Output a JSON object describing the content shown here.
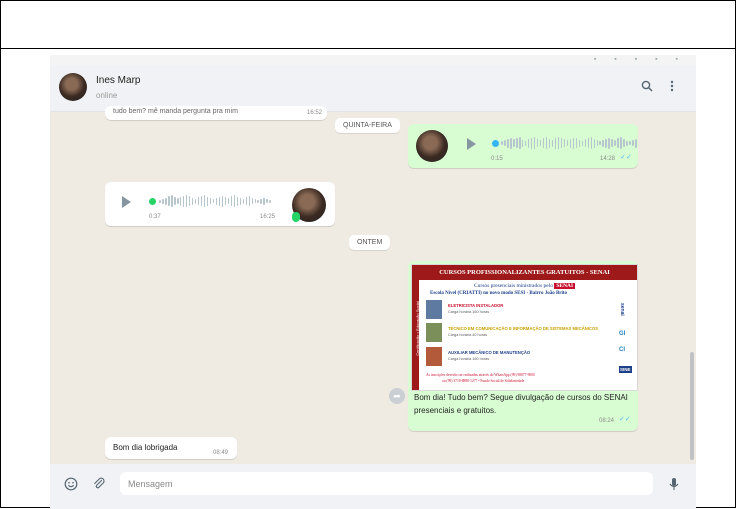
{
  "contact": {
    "name": "Ines Marp",
    "status": "online"
  },
  "messages": [
    {
      "type": "text",
      "direction": "incoming",
      "text": "tudo bem? mê manda pergunta pra mim",
      "time": "16:52"
    },
    {
      "type": "date",
      "text": "QUINTA-FEIRA"
    },
    {
      "type": "audio",
      "direction": "outgoing",
      "duration": "0:15",
      "time": "14:28",
      "status": "read"
    },
    {
      "type": "audio",
      "direction": "incoming",
      "duration": "0:37",
      "time": "16:25"
    },
    {
      "type": "date",
      "text": "ONTEM"
    },
    {
      "type": "image",
      "direction": "outgoing",
      "flyer": {
        "heading": "CURSOS PROFISSIONALIZANTES GRATUITOS - SENAI",
        "line1": "Cursos presenciais ministrados pelo",
        "line1_badge": "SENAI",
        "line2": "Escola Nível (CRIATTI) no novo modo SESI - Bairro João Brito",
        "side_band": "Certificação • Educação Social",
        "courses": [
          {
            "title": "ELETRICISTA INSTALADOR",
            "subtitle": "Carga horária 160 horas"
          },
          {
            "title": "TÉCNICO EM COMUNICAÇÃO E INFORMAÇÃO DE SISTEMAS MECÂNICOS",
            "subtitle": "Carga horária 40 horas"
          },
          {
            "title": "AUXILIAR MECÂNICO DE MANUTENÇÃO",
            "subtitle": "Carga horária 160 horas"
          }
        ],
        "logos": [
          "senai",
          "GI",
          "CI",
          "SINE"
        ],
        "footer1": "As inscrições deverão ser realizadas através do WhatsApp (99) 98877-9000",
        "footer2": "ou (99) 3718-8888-1277 • Fundo Social de Solidariedade"
      },
      "caption": "Bom dia! Tudo bem? Segue divulgação de cursos do SENAI presenciais e gratuitos.",
      "time": "08:24",
      "status": "read"
    },
    {
      "type": "text",
      "direction": "incoming",
      "text": "Bom dia lobrigada",
      "time": "08:49"
    }
  ],
  "composer": {
    "placeholder": "Mensagem"
  },
  "colors": {
    "incoming_bubble": "#ffffff",
    "outgoing_bubble": "#d9fdd3",
    "chat_bg": "#efeae2",
    "read_ticks": "#53bdeb",
    "flyer_red": "#9e1a1a"
  }
}
